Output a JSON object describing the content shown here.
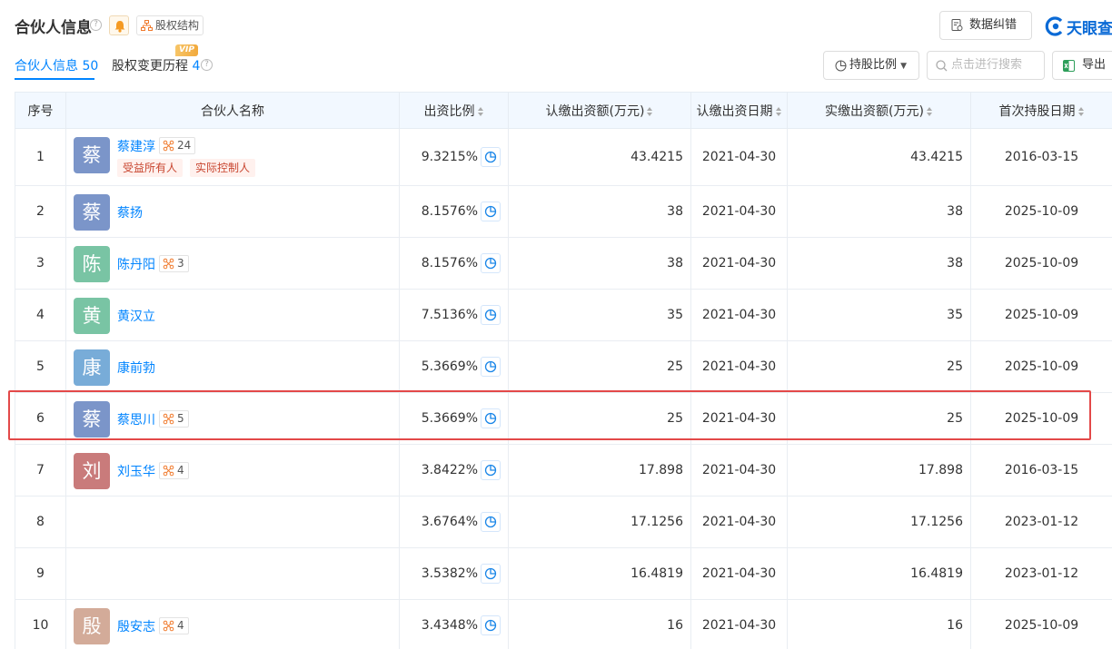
{
  "header": {
    "title": "合伙人信息",
    "equity_label": "股权结构",
    "correct_label": "数据纠错",
    "logo_text": "天眼查"
  },
  "tabs": [
    {
      "label": "合伙人信息",
      "count": "50"
    },
    {
      "label": "股权变更历程",
      "count": "4",
      "badge": "VIP"
    }
  ],
  "toolbar": {
    "ratio_label": "持股比例",
    "search_placeholder": "点击进行搜索",
    "export_label": "导出"
  },
  "table": {
    "columns": [
      "序号",
      "合伙人名称",
      "出资比例",
      "认缴出资额(万元)",
      "认缴出资日期",
      "实缴出资额(万元)",
      "首次持股日期"
    ],
    "rows": [
      {
        "idx": "1",
        "avatar": "蔡",
        "avatar_color": "#7b95c9",
        "name": "蔡建淳",
        "rel": "24",
        "tags": [
          "受益所有人",
          "实际控制人"
        ],
        "ratio": "9.3215%",
        "subscribed": "43.4215",
        "sub_date": "2021-04-30",
        "paid": "43.4215",
        "first_date": "2016-03-15"
      },
      {
        "idx": "2",
        "avatar": "蔡",
        "avatar_color": "#7b95c9",
        "name": "蔡扬",
        "rel": "",
        "tags": [],
        "ratio": "8.1576%",
        "subscribed": "38",
        "sub_date": "2021-04-30",
        "paid": "38",
        "first_date": "2025-10-09"
      },
      {
        "idx": "3",
        "avatar": "陈",
        "avatar_color": "#79c4a4",
        "name": "陈丹阳",
        "rel": "3",
        "tags": [],
        "ratio": "8.1576%",
        "subscribed": "38",
        "sub_date": "2021-04-30",
        "paid": "38",
        "first_date": "2025-10-09"
      },
      {
        "idx": "4",
        "avatar": "黄",
        "avatar_color": "#79c4a4",
        "name": "黄汉立",
        "rel": "",
        "tags": [],
        "ratio": "7.5136%",
        "subscribed": "35",
        "sub_date": "2021-04-30",
        "paid": "35",
        "first_date": "2025-10-09"
      },
      {
        "idx": "5",
        "avatar": "康",
        "avatar_color": "#78acd8",
        "name": "康前勃",
        "rel": "",
        "tags": [],
        "ratio": "5.3669%",
        "subscribed": "25",
        "sub_date": "2021-04-30",
        "paid": "25",
        "first_date": "2025-10-09"
      },
      {
        "idx": "6",
        "avatar": "蔡",
        "avatar_color": "#7b95c9",
        "name": "蔡思川",
        "rel": "5",
        "tags": [],
        "ratio": "5.3669%",
        "subscribed": "25",
        "sub_date": "2021-04-30",
        "paid": "25",
        "first_date": "2025-10-09"
      },
      {
        "idx": "7",
        "avatar": "刘",
        "avatar_color": "#c97b7b",
        "name": "刘玉华",
        "rel": "4",
        "tags": [],
        "ratio": "3.8422%",
        "subscribed": "17.898",
        "sub_date": "2021-04-30",
        "paid": "17.898",
        "first_date": "2016-03-15"
      },
      {
        "idx": "8",
        "avatar": "",
        "avatar_color": "",
        "name": "",
        "rel": "",
        "tags": [],
        "ratio": "3.6764%",
        "subscribed": "17.1256",
        "sub_date": "2021-04-30",
        "paid": "17.1256",
        "first_date": "2023-01-12"
      },
      {
        "idx": "9",
        "avatar": "",
        "avatar_color": "",
        "name": "",
        "rel": "",
        "tags": [],
        "ratio": "3.5382%",
        "subscribed": "16.4819",
        "sub_date": "2021-04-30",
        "paid": "16.4819",
        "first_date": "2023-01-12"
      },
      {
        "idx": "10",
        "avatar": "殷",
        "avatar_color": "#d3ab99",
        "name": "殷安志",
        "rel": "4",
        "tags": [],
        "ratio": "3.4348%",
        "subscribed": "16",
        "sub_date": "2021-04-30",
        "paid": "16",
        "first_date": "2025-10-09"
      }
    ]
  },
  "colors": {
    "accent": "#0084ff",
    "highlight": "#e34949",
    "header_bg": "#f2f8ff"
  }
}
